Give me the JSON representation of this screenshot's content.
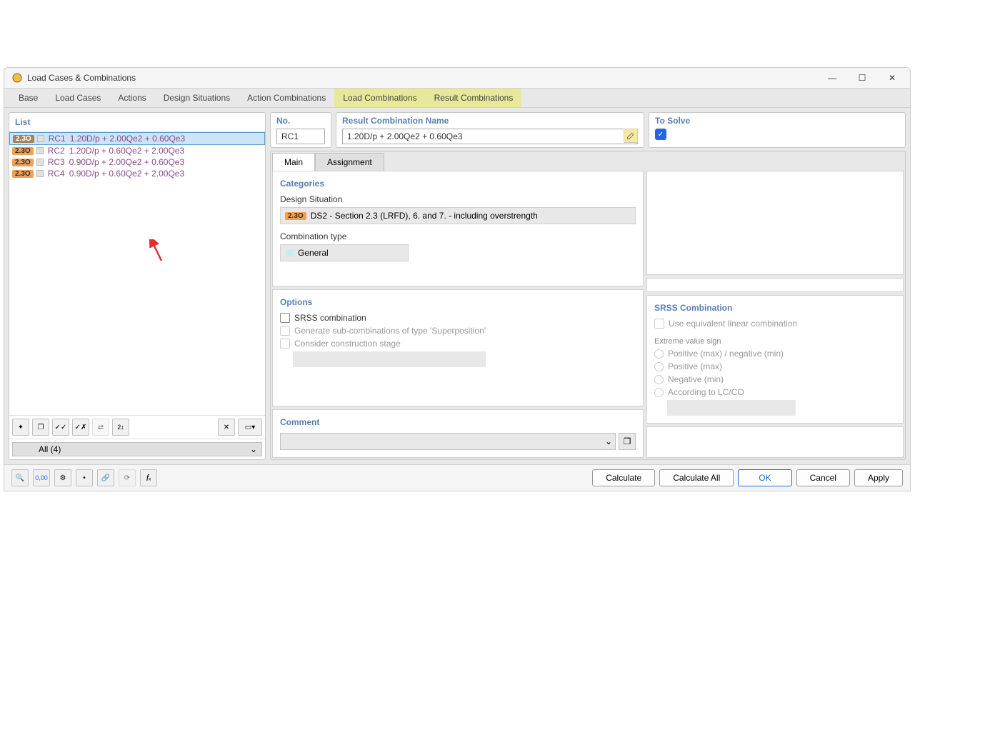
{
  "window": {
    "title": "Load Cases & Combinations"
  },
  "mainTabs": {
    "base": "Base",
    "loadCases": "Load Cases",
    "actions": "Actions",
    "designSituations": "Design Situations",
    "actionCombinations": "Action Combinations",
    "loadCombinations": "Load Combinations",
    "resultCombinations": "Result Combinations"
  },
  "leftPanel": {
    "listLabel": "List",
    "badge": "2.3O",
    "rows": [
      {
        "id": "RC1",
        "name": "1.20D/p + 2.00Qe2 + 0.60Qe3",
        "selected": true
      },
      {
        "id": "RC2",
        "name": "1.20D/p + 0.60Qe2 + 2.00Qe3",
        "selected": false
      },
      {
        "id": "RC3",
        "name": "0.90D/p + 2.00Qe2 + 0.60Qe3",
        "selected": false
      },
      {
        "id": "RC4",
        "name": "0.90D/p + 0.60Qe2 + 2.00Qe3",
        "selected": false
      }
    ],
    "filter": "All (4)"
  },
  "header": {
    "noLabel": "No.",
    "noValue": "RC1",
    "nameLabel": "Result Combination Name",
    "nameValue": "1.20D/p + 2.00Qe2 + 0.60Qe3",
    "solveLabel": "To Solve"
  },
  "subTabs": {
    "main": "Main",
    "assignment": "Assignment"
  },
  "categories": {
    "title": "Categories",
    "dsLabel": "Design Situation",
    "dsBadge": "2.3O",
    "dsValue": "DS2 - Section 2.3 (LRFD), 6. and 7. - including overstrength",
    "typeLabel": "Combination type",
    "typeValue": "General"
  },
  "options": {
    "title": "Options",
    "srss": "SRSS combination",
    "generate": "Generate sub-combinations of type 'Superposition'",
    "consider": "Consider construction stage"
  },
  "srssPanel": {
    "title": "SRSS Combination",
    "useEquiv": "Use equivalent linear combination",
    "extremeLabel": "Extreme value sign",
    "opt1": "Positive (max) / negative (min)",
    "opt2": "Positive (max)",
    "opt3": "Negative (min)",
    "opt4": "According to LC/CO"
  },
  "comment": {
    "label": "Comment"
  },
  "buttons": {
    "calculate": "Calculate",
    "calculateAll": "Calculate All",
    "ok": "OK",
    "cancel": "Cancel",
    "apply": "Apply"
  }
}
